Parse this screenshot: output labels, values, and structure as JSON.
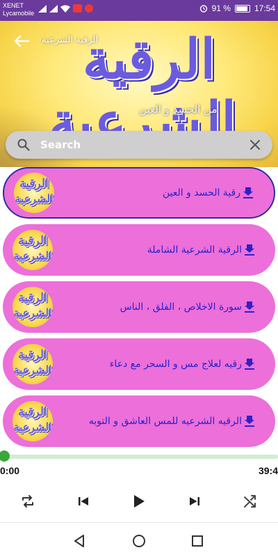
{
  "status_bar": {
    "carrier_line1": "XENET",
    "carrier_line2": "Lycamobile",
    "battery": "91 %",
    "time": "17:54"
  },
  "header": {
    "banner_title_line1": "الرقية",
    "banner_title_line2": "الشرعية",
    "banner_subtitle": "الرقية الشرعية",
    "banner_subtitle_2": "من الحسد و العين"
  },
  "search": {
    "placeholder": "Search",
    "value": ""
  },
  "thumbnail": {
    "line1": "الرقية",
    "line2": "الشرعية"
  },
  "tracks": [
    {
      "title": "رقية الحسد و العين",
      "selected": true
    },
    {
      "title": "الرقية الشرعية الشاملة",
      "selected": false
    },
    {
      "title": "سورة الاخلاص ، الفلق ، الناس",
      "selected": false
    },
    {
      "title": "رقيه لعلاج مس و السحر مع دعاء",
      "selected": false
    },
    {
      "title": "الرقيه الشرعيه للمس العاشق و التوبه",
      "selected": false
    }
  ],
  "player": {
    "current_time": "0:00",
    "total_time": "39:4",
    "progress": 0.0
  },
  "colors": {
    "status_bar": "#6a3a9c",
    "item_background": "#ed6fd9",
    "item_text": "#2b22c9",
    "selected_border": "#2b2fa8",
    "progress_fill": "#3aa83a",
    "progress_track": "#d2ecd2"
  },
  "icons": {
    "back": "arrow-left-icon",
    "search": "search-icon",
    "clear": "close-icon",
    "download": "download-icon",
    "repeat": "repeat-icon",
    "previous": "skip-previous-icon",
    "play": "play-icon",
    "next": "skip-next-icon",
    "shuffle": "shuffle-icon"
  }
}
